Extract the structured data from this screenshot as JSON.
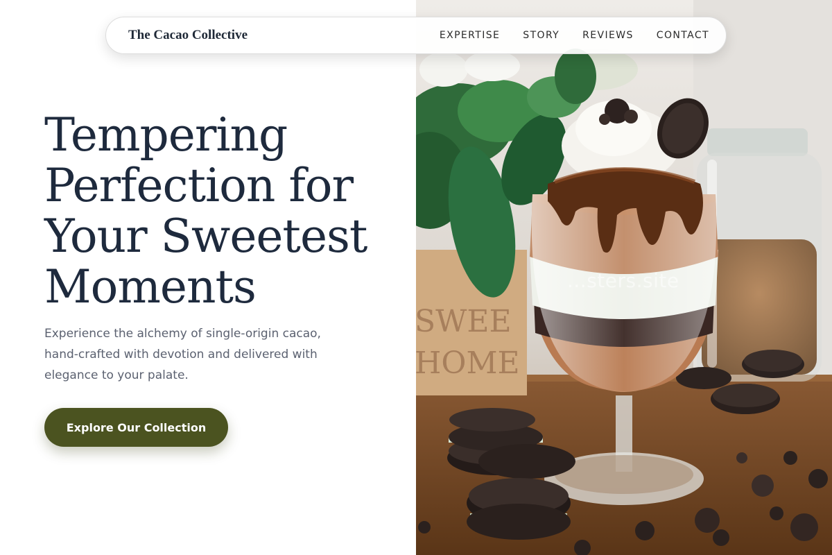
{
  "nav": {
    "brand": "The Cacao Collective",
    "links": [
      "EXPERTISE",
      "STORY",
      "REVIEWS",
      "CONTACT"
    ]
  },
  "hero": {
    "headline_lines": [
      "Tempering",
      "Perfection for",
      "Your Sweetest",
      "Moments"
    ],
    "subtext_lines": [
      "Experience the alchemy of single-origin cacao,",
      "hand-crafted with devotion and delivered with",
      "elegance to your palate."
    ],
    "cta_label": "Explore Our Collection"
  },
  "image": {
    "watermark": "...sters.site",
    "sign_text": [
      "SWEE",
      "HOME"
    ]
  },
  "colors": {
    "accent": "#4b5320",
    "headline": "#1e2a3d",
    "body_text": "#5b6170"
  }
}
